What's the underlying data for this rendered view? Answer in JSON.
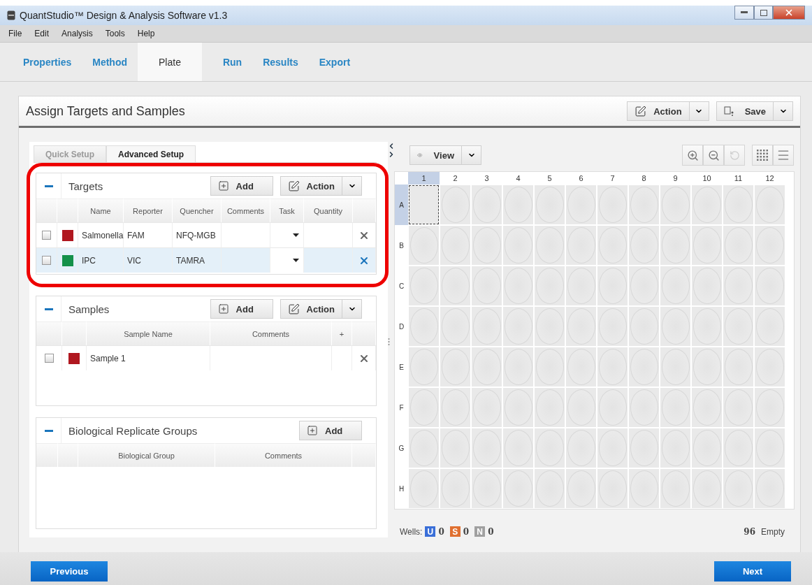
{
  "window": {
    "title": "QuantStudio™ Design & Analysis Software v1.3"
  },
  "menu": [
    "File",
    "Edit",
    "Analysis",
    "Tools",
    "Help"
  ],
  "steps": [
    {
      "label": "Properties",
      "selected": false
    },
    {
      "label": "Method",
      "selected": false
    },
    {
      "label": "Plate",
      "selected": true
    },
    {
      "label": "Run",
      "selected": false
    },
    {
      "label": "Results",
      "selected": false
    },
    {
      "label": "Export",
      "selected": false
    }
  ],
  "page": {
    "title": "Assign Targets and Samples",
    "buttons": [
      {
        "label": "Action",
        "kind": "action"
      },
      {
        "label": "Save",
        "kind": "save"
      }
    ]
  },
  "setup_tabs": [
    {
      "label": "Quick Setup",
      "selected": false
    },
    {
      "label": "Advanced Setup",
      "selected": true
    }
  ],
  "targets": {
    "title": "Targets",
    "highlighted": true,
    "add": "Add",
    "action": "Action",
    "columns": [
      "Name",
      "Reporter",
      "Quencher",
      "Comments",
      "Task",
      "Quantity"
    ],
    "rows": [
      {
        "checked": false,
        "selected": false,
        "color": "#b0171f",
        "name": "Salmonella",
        "reporter": "FAM",
        "quencher": "NFQ-MGB"
      },
      {
        "checked": false,
        "selected": true,
        "color": "#14914a",
        "name": "IPC",
        "reporter": "VIC",
        "quencher": "TAMRA"
      }
    ]
  },
  "samples": {
    "title": "Samples",
    "add": "Add",
    "action": "Action",
    "columns": [
      "Sample Name",
      "Comments",
      "+"
    ],
    "rows": [
      {
        "checked": false,
        "color": "#b0171f",
        "name": "Sample 1"
      }
    ]
  },
  "replicate_groups": {
    "title": "Biological Replicate Groups",
    "add": "Add",
    "columns": [
      "Biological Group",
      "Comments"
    ]
  },
  "plate": {
    "view": "View",
    "columns": [
      {
        "label": "1",
        "selected": true
      },
      {
        "label": "2",
        "selected": false
      },
      {
        "label": "3",
        "selected": false
      },
      {
        "label": "4",
        "selected": false
      },
      {
        "label": "5",
        "selected": false
      },
      {
        "label": "6",
        "selected": false
      },
      {
        "label": "7",
        "selected": false
      },
      {
        "label": "8",
        "selected": false
      },
      {
        "label": "9",
        "selected": false
      },
      {
        "label": "10",
        "selected": false
      },
      {
        "label": "11",
        "selected": false
      },
      {
        "label": "12",
        "selected": false
      }
    ],
    "rows": [
      {
        "label": "A",
        "selected": true,
        "wells": [
          {
            "selected": true
          },
          {
            "selected": false
          },
          {
            "selected": false
          },
          {
            "selected": false
          },
          {
            "selected": false
          },
          {
            "selected": false
          },
          {
            "selected": false
          },
          {
            "selected": false
          },
          {
            "selected": false
          },
          {
            "selected": false
          },
          {
            "selected": false
          },
          {
            "selected": false
          }
        ]
      },
      {
        "label": "B",
        "selected": false,
        "wells": [
          {
            "selected": false
          },
          {
            "selected": false
          },
          {
            "selected": false
          },
          {
            "selected": false
          },
          {
            "selected": false
          },
          {
            "selected": false
          },
          {
            "selected": false
          },
          {
            "selected": false
          },
          {
            "selected": false
          },
          {
            "selected": false
          },
          {
            "selected": false
          },
          {
            "selected": false
          }
        ]
      },
      {
        "label": "C",
        "selected": false,
        "wells": [
          {
            "selected": false
          },
          {
            "selected": false
          },
          {
            "selected": false
          },
          {
            "selected": false
          },
          {
            "selected": false
          },
          {
            "selected": false
          },
          {
            "selected": false
          },
          {
            "selected": false
          },
          {
            "selected": false
          },
          {
            "selected": false
          },
          {
            "selected": false
          },
          {
            "selected": false
          }
        ]
      },
      {
        "label": "D",
        "selected": false,
        "wells": [
          {
            "selected": false
          },
          {
            "selected": false
          },
          {
            "selected": false
          },
          {
            "selected": false
          },
          {
            "selected": false
          },
          {
            "selected": false
          },
          {
            "selected": false
          },
          {
            "selected": false
          },
          {
            "selected": false
          },
          {
            "selected": false
          },
          {
            "selected": false
          },
          {
            "selected": false
          }
        ]
      },
      {
        "label": "E",
        "selected": false,
        "wells": [
          {
            "selected": false
          },
          {
            "selected": false
          },
          {
            "selected": false
          },
          {
            "selected": false
          },
          {
            "selected": false
          },
          {
            "selected": false
          },
          {
            "selected": false
          },
          {
            "selected": false
          },
          {
            "selected": false
          },
          {
            "selected": false
          },
          {
            "selected": false
          },
          {
            "selected": false
          }
        ]
      },
      {
        "label": "F",
        "selected": false,
        "wells": [
          {
            "selected": false
          },
          {
            "selected": false
          },
          {
            "selected": false
          },
          {
            "selected": false
          },
          {
            "selected": false
          },
          {
            "selected": false
          },
          {
            "selected": false
          },
          {
            "selected": false
          },
          {
            "selected": false
          },
          {
            "selected": false
          },
          {
            "selected": false
          },
          {
            "selected": false
          }
        ]
      },
      {
        "label": "G",
        "selected": false,
        "wells": [
          {
            "selected": false
          },
          {
            "selected": false
          },
          {
            "selected": false
          },
          {
            "selected": false
          },
          {
            "selected": false
          },
          {
            "selected": false
          },
          {
            "selected": false
          },
          {
            "selected": false
          },
          {
            "selected": false
          },
          {
            "selected": false
          },
          {
            "selected": false
          },
          {
            "selected": false
          }
        ]
      },
      {
        "label": "H",
        "selected": false,
        "wells": [
          {
            "selected": false
          },
          {
            "selected": false
          },
          {
            "selected": false
          },
          {
            "selected": false
          },
          {
            "selected": false
          },
          {
            "selected": false
          },
          {
            "selected": false
          },
          {
            "selected": false
          },
          {
            "selected": false
          },
          {
            "selected": false
          },
          {
            "selected": false
          },
          {
            "selected": false
          }
        ]
      }
    ]
  },
  "wells_summary": {
    "label": "Wells:",
    "counts": [
      {
        "letter": "U",
        "count": "0",
        "color": "#3a6fd8"
      },
      {
        "letter": "S",
        "count": "0",
        "color": "#e07030"
      },
      {
        "letter": "N",
        "count": "0",
        "color": "#a0a0a0"
      }
    ],
    "empty_count": "96",
    "empty_label": "Empty"
  },
  "footer": {
    "previous": "Previous",
    "next": "Next"
  }
}
